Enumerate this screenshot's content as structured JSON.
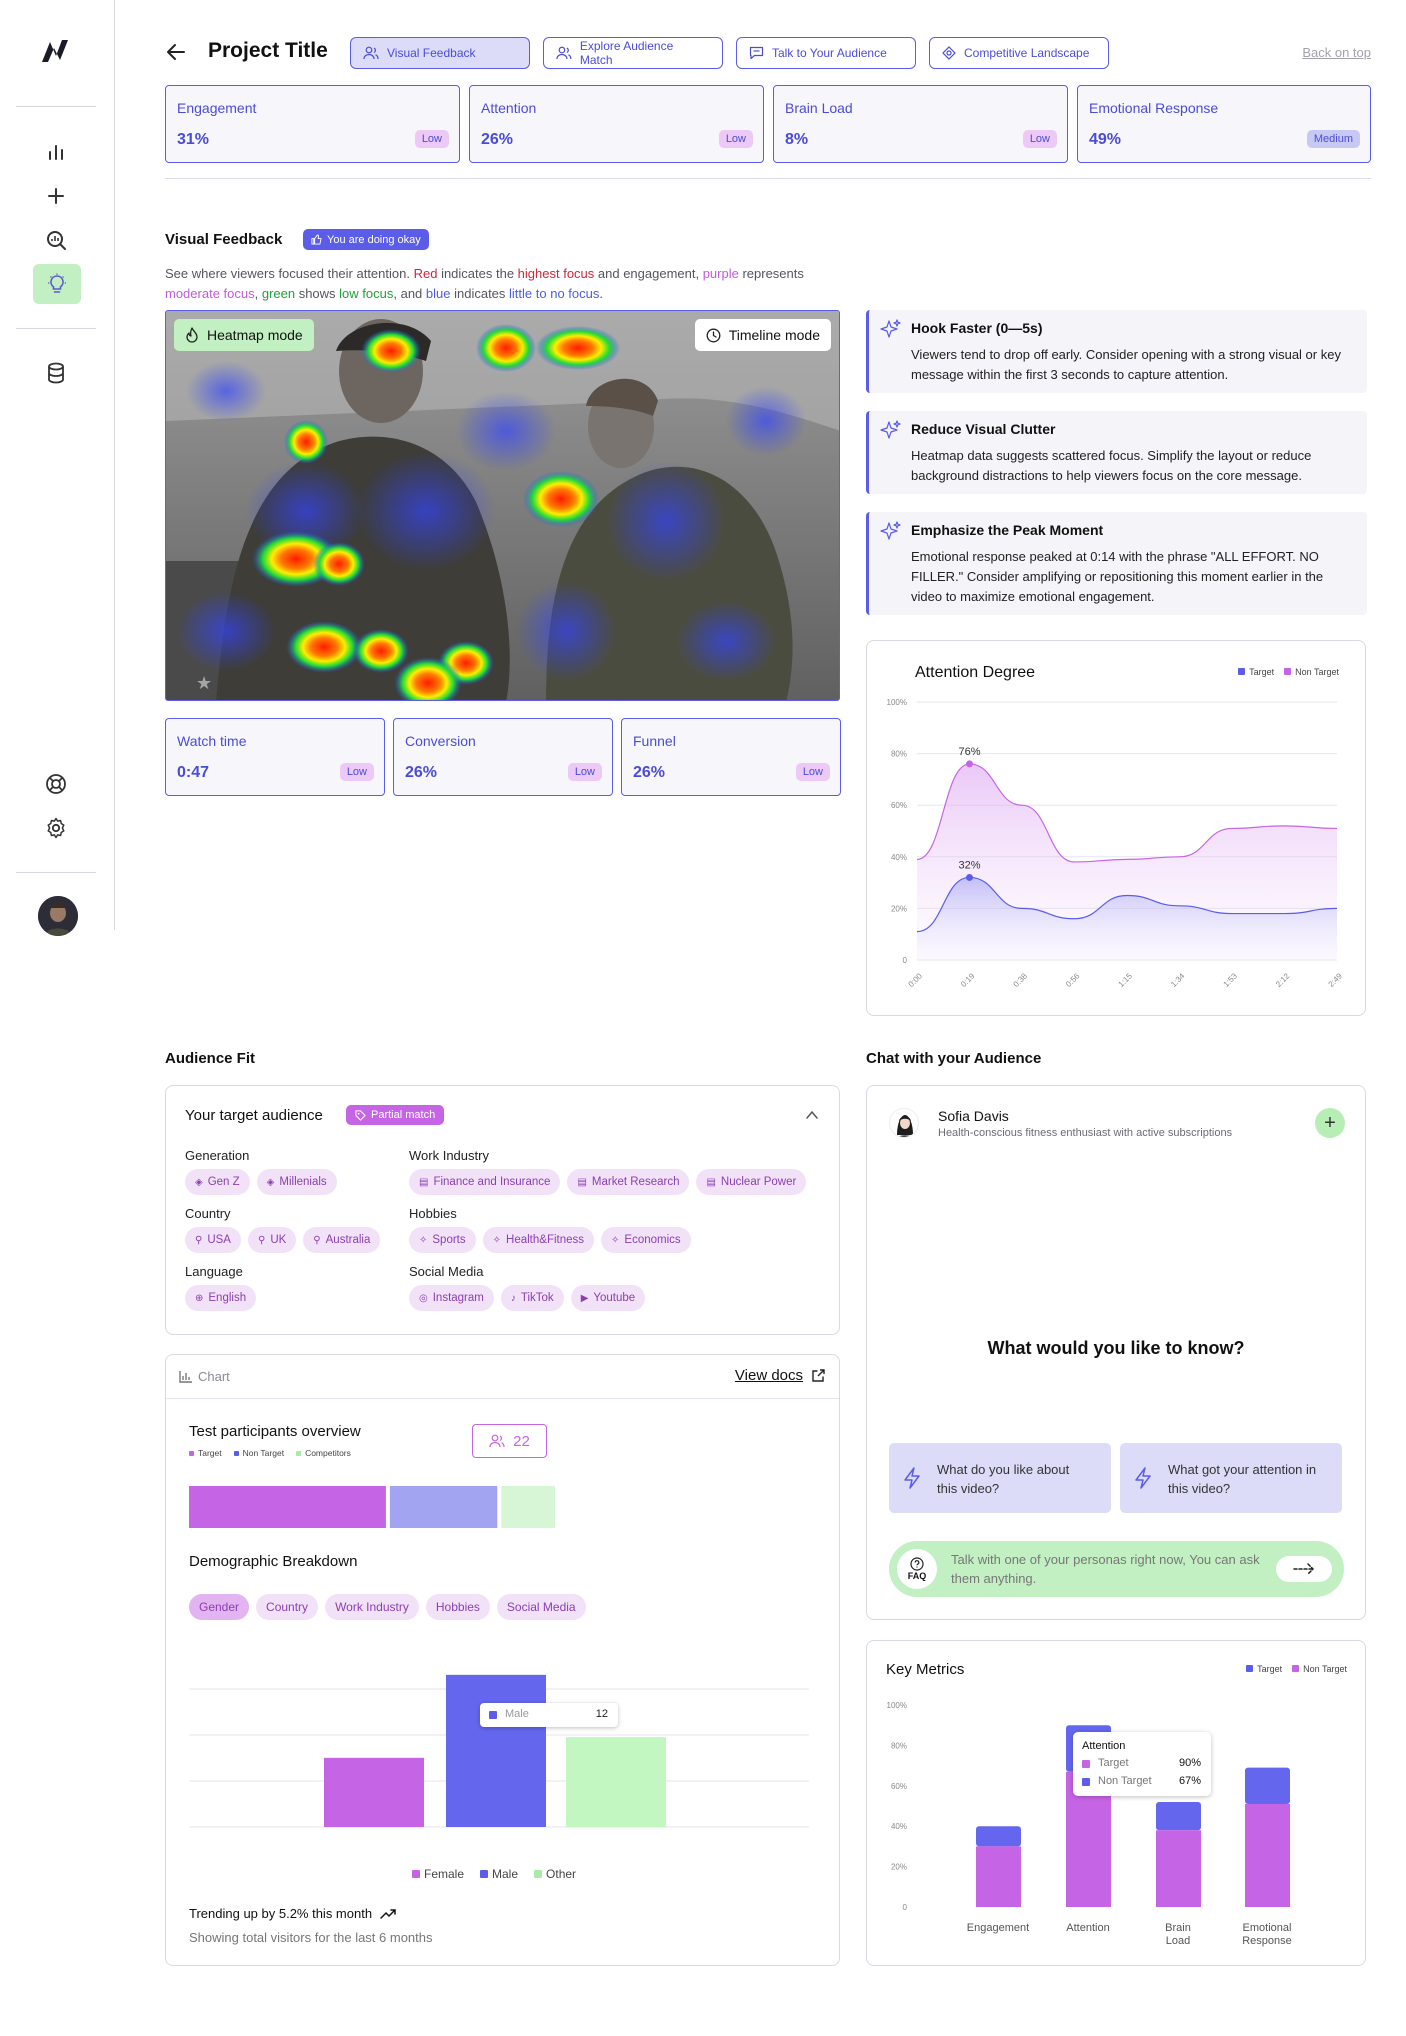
{
  "header": {
    "title": "Project Title",
    "back_top": "Back on top",
    "tabs": [
      {
        "label": "Visual Feedback",
        "active": true
      },
      {
        "label": "Explore Audience Match"
      },
      {
        "label": "Talk to Your Audience"
      },
      {
        "label": "Competitive Landscape"
      }
    ]
  },
  "metrics": [
    {
      "label": "Engagement",
      "value": "31%",
      "badge": "Low"
    },
    {
      "label": "Attention",
      "value": "26%",
      "badge": "Low"
    },
    {
      "label": "Brain Load",
      "value": "8%",
      "badge": "Low"
    },
    {
      "label": "Emotional Response",
      "value": "49%",
      "badge": "Medium"
    }
  ],
  "visual_feedback": {
    "title": "Visual Feedback",
    "badge": "You are doing okay",
    "desc": {
      "p1": "See where viewers focused their attention. ",
      "red": "Red",
      "p2": " indicates the ",
      "red2": "highest focus",
      "p3": " and engagement, ",
      "pur": "purple",
      "p4": " represents ",
      "pur2": "moderate focus",
      "p5": ", ",
      "grn": "green",
      "p6": " shows ",
      "grn2": "low focus",
      "p7": ", and ",
      "blu": "blue",
      "p8": " indicates ",
      "blu2": "little to no focus",
      "p9": "."
    },
    "heatmap_mode": "Heatmap mode",
    "timeline_mode": "Timeline mode",
    "bottom_metrics": [
      {
        "label": "Watch time",
        "value": "0:47",
        "badge": "Low"
      },
      {
        "label": "Conversion",
        "value": "26%",
        "badge": "Low"
      },
      {
        "label": "Funnel",
        "value": "26%",
        "badge": "Low"
      }
    ]
  },
  "tips": [
    {
      "title": "Hook Faster (0—5s)",
      "body": "Viewers tend to drop off early. Consider opening with a strong visual or key message within the first 3 seconds to capture attention."
    },
    {
      "title": "Reduce Visual Clutter",
      "body": "Heatmap data suggests scattered focus. Simplify the layout or reduce background distractions to help viewers focus on the core message."
    },
    {
      "title": "Emphasize the Peak Moment",
      "body": "Emotional response peaked at 0:14 with the phrase \"ALL EFFORT. NO FILLER.\" Consider amplifying or repositioning this moment earlier in the video to maximize emotional engagement."
    }
  ],
  "attention_chart": {
    "title": "Attention Degree",
    "legend_target": "Target",
    "legend_non_target": "Non Target",
    "y_ticks": [
      "100%",
      "80%",
      "60%",
      "40%",
      "20%",
      "0"
    ],
    "x_ticks": [
      "0:00",
      "0:19",
      "0:38",
      "0:56",
      "1:15",
      "1:34",
      "1:53",
      "2:12",
      "2:49"
    ],
    "peak_label_non_target": "76%",
    "peak_label_target": "32%"
  },
  "audience": {
    "section_title": "Audience Fit",
    "card_title": "Your target audience",
    "badge": "Partial match",
    "generation_label": "Generation",
    "generation": [
      "Gen Z",
      "Millenials"
    ],
    "country_label": "Country",
    "country": [
      "USA",
      "UK",
      "Australia"
    ],
    "language_label": "Language",
    "language": [
      "English"
    ],
    "industry_label": "Work Industry",
    "industry": [
      "Finance and Insurance",
      "Market Research",
      "Nuclear Power"
    ],
    "hobbies_label": "Hobbies",
    "hobbies": [
      "Sports",
      "Health&Fitness",
      "Economics"
    ],
    "social_label": "Social Media",
    "social": [
      "Instagram",
      "TikTok",
      "Youtube"
    ]
  },
  "participants_card": {
    "head_label": "Chart",
    "view_docs": "View docs",
    "title": "Test participants overview",
    "legend": [
      "Target",
      "Non Target",
      "Competitors"
    ],
    "count": "22",
    "demo_title": "Demographic Breakdown",
    "demo_tabs": [
      "Gender",
      "Country",
      "Work Industry",
      "Hobbies",
      "Social Media"
    ],
    "gender_legend": [
      "Female",
      "Male",
      "Other"
    ],
    "tooltip_label": "Male",
    "tooltip_value": "12",
    "trend": "Trending up by 5.2% this month",
    "trend_sub": "Showing total visitors for the last 6 months"
  },
  "chat": {
    "section_title": "Chat with your Audience",
    "persona_name": "Sofia Davis",
    "persona_desc": "Health-conscious fitness enthusiast with active subscriptions",
    "ask_title": "What would you like to know?",
    "q1": "What do you like about this video?",
    "q2": "What got your attention in this video?",
    "faq_label": "FAQ",
    "faq_placeholder": "Talk with one of your personas right now, You can ask them anything."
  },
  "key_metrics": {
    "title": "Key Metrics",
    "legend_target": "Target",
    "legend_non_target": "Non Target",
    "y_ticks": [
      "100%",
      "80%",
      "60%",
      "40%",
      "20%",
      "0"
    ],
    "tooltip_title": "Attention",
    "tooltip_target": "Target",
    "tooltip_target_val": "90%",
    "tooltip_non_target": "Non Target",
    "tooltip_non_target_val": "67%"
  },
  "colors": {
    "accent": "#5b5ce8",
    "purple": "#c664e6",
    "green": "#c2f0c2"
  },
  "chart_data": [
    {
      "type": "area",
      "title": "Attention Degree",
      "x": [
        "0:00",
        "0:19",
        "0:38",
        "0:56",
        "1:15",
        "1:34",
        "1:53",
        "2:12",
        "2:49"
      ],
      "ylim": [
        0,
        100
      ],
      "series": [
        {
          "name": "Non Target",
          "values": [
            39,
            76,
            60,
            38,
            39,
            40,
            51,
            52,
            51
          ]
        },
        {
          "name": "Target",
          "values": [
            11,
            32,
            20,
            16,
            25,
            21,
            18,
            18,
            20
          ]
        }
      ],
      "annotations": [
        {
          "x": "0:19",
          "series": "Non Target",
          "label": "76%"
        },
        {
          "x": "0:19",
          "series": "Target",
          "label": "32%"
        }
      ],
      "legend": "top-right",
      "grid": true
    },
    {
      "type": "bar",
      "title": "Test participants overview",
      "categories": [
        "Target",
        "Non Target",
        "Competitors"
      ],
      "values": [
        11,
        6,
        3
      ],
      "stacked": "horizontal"
    },
    {
      "type": "bar",
      "title": "Demographic Breakdown",
      "categories": [
        "Female",
        "Male",
        "Other"
      ],
      "values": [
        5,
        11,
        6.5
      ]
    },
    {
      "type": "bar",
      "title": "Key Metrics",
      "categories": [
        "Engagement",
        "Attention",
        "Brain Load",
        "Emotional Response"
      ],
      "ylim": [
        0,
        100
      ],
      "stacked": true,
      "series": [
        {
          "name": "Target",
          "values": [
            40,
            90,
            52,
            69
          ]
        },
        {
          "name": "Non Target",
          "values": [
            30,
            67,
            38,
            51
          ]
        }
      ],
      "legend": "top-right",
      "grid": false
    }
  ]
}
